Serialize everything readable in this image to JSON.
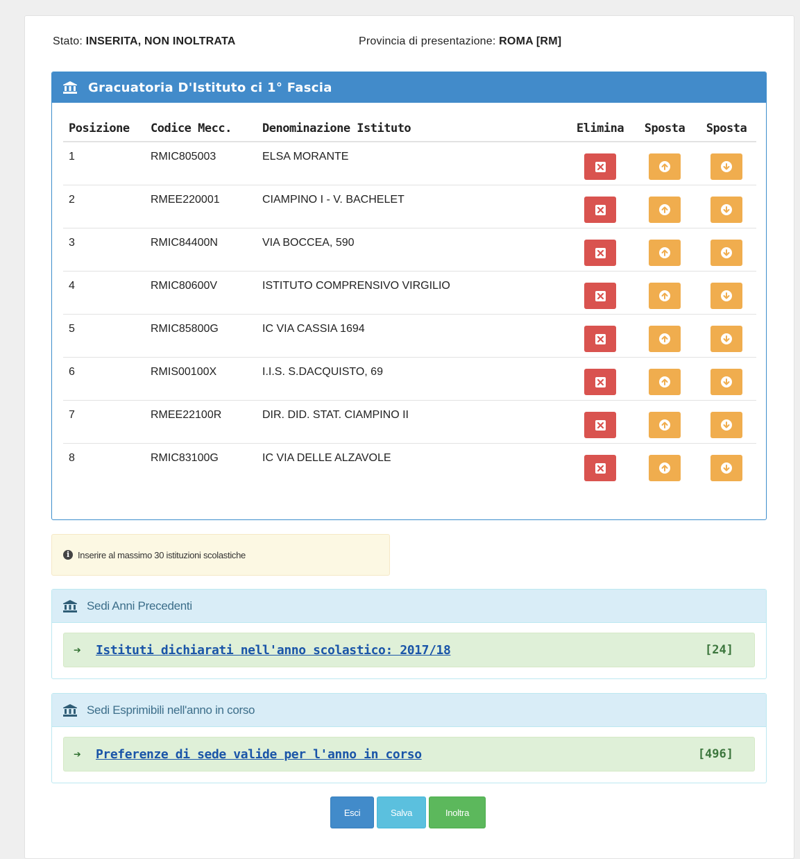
{
  "status": {
    "stato_label": "Stato:",
    "stato_value": "INSERITA, NON INOLTRATA",
    "provincia_label": "Provincia di presentazione:",
    "provincia_value": "ROMA [RM]"
  },
  "graduatoria": {
    "title": "Gracuatoria D'Istituto ci 1° Fascia",
    "icon": "bank-icon",
    "columns": [
      "Posizione",
      "Codice Mecc.",
      "Denominazione Istituto",
      "Elimina",
      "Sposta",
      "Sposta"
    ],
    "rows": [
      {
        "pos": "1",
        "codice": "RMIC805003",
        "nome": "ELSA MORANTE"
      },
      {
        "pos": "2",
        "codice": "RMEE220001",
        "nome": "CIAMPINO I - V. BACHELET"
      },
      {
        "pos": "3",
        "codice": "RMIC84400N",
        "nome": "VIA BOCCEA, 590"
      },
      {
        "pos": "4",
        "codice": "RMIC80600V",
        "nome": "ISTITUTO COMPRENSIVO VIRGILIO"
      },
      {
        "pos": "5",
        "codice": "RMIC85800G",
        "nome": "IC VIA CASSIA 1694"
      },
      {
        "pos": "6",
        "codice": "RMIS00100X",
        "nome": "I.I.S. S.DACQUISTO, 69"
      },
      {
        "pos": "7",
        "codice": "RMEE22100R",
        "nome": "DIR. DID. STAT. CIAMPINO II"
      },
      {
        "pos": "8",
        "codice": "RMIC83100G",
        "nome": "IC VIA DELLE ALZAVOLE"
      }
    ]
  },
  "alert": {
    "text": "Inserire al massimo 30 istituzioni scolastiche"
  },
  "sedi_precedenti": {
    "title": "Sedi Anni Precedenti",
    "link_text": "Istituti dichiarati nell'anno scolastico:  2017/18",
    "count": "[24]"
  },
  "sedi_esprimibili": {
    "title": "Sedi Esprimibili nell'anno in corso",
    "link_text": "Preferenze di sede valide per l'anno in corso",
    "count": "[496]"
  },
  "buttons": {
    "esci": "Esci",
    "salva": "Salva",
    "inoltra": "Inoltra"
  },
  "colors": {
    "primary": "#428bca",
    "danger": "#d9534f",
    "warning": "#f0ad4e",
    "success": "#5cb85c",
    "info": "#5bc0de"
  }
}
